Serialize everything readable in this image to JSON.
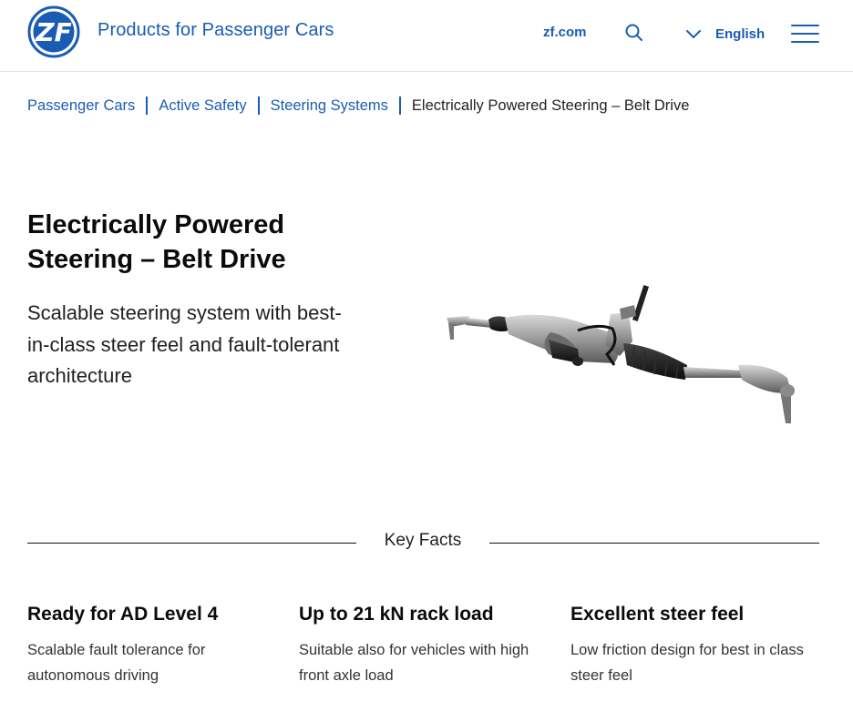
{
  "header": {
    "site_title": "Products for Passenger Cars",
    "zf_link": "zf.com",
    "language": "English",
    "brand_color": "#1a5cb4"
  },
  "logo": {
    "text": "ZF"
  },
  "breadcrumb": {
    "items": [
      "Passenger Cars",
      "Active Safety",
      "Steering Systems"
    ],
    "current": "Electrically Powered Steering – Belt Drive"
  },
  "hero": {
    "title_line1": "Electrically Powered",
    "title_line2": "Steering – Belt Drive",
    "subtitle": "Scalable steering system with best-in-class steer feel and fault-tolerant architecture"
  },
  "key_facts": {
    "heading": "Key Facts",
    "items": [
      {
        "title": "Ready for AD Level 4",
        "description": "Scalable fault tolerance for autonomous driving"
      },
      {
        "title": "Up to 21 kN rack load",
        "description": "Suitable also for vehicles with high front axle load"
      },
      {
        "title": "Excellent steer feel",
        "description": "Low friction design for best in class steer feel"
      }
    ]
  }
}
